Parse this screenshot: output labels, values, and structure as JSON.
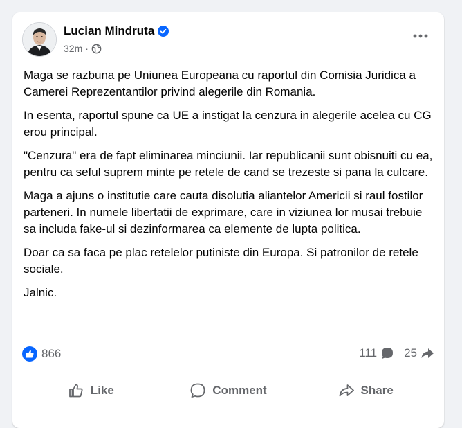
{
  "post": {
    "author": "Lucian Mindruta",
    "time": "32m",
    "separator": "·",
    "paragraphs": [
      "Maga se razbuna pe Uniunea Europeana cu raportul din Comisia Juridica a Camerei Reprezentantilor privind alegerile din Romania.",
      "In esenta, raportul spune ca UE a instigat la cenzura in alegerile acelea cu CG erou principal.",
      "\"Cenzura\" era de fapt eliminarea minciunii. Iar republicanii sunt obisnuiti cu ea, pentru ca seful suprem minte pe retele de cand se trezeste si pana la culcare.",
      "Maga a ajuns o institutie care cauta disolutia aliantelor Americii si raul fostilor parteneri. In numele libertatii de exprimare, care in viziunea lor musai trebuie sa includa fake-ul si dezinformarea ca elemente de lupta politica.",
      "Doar ca sa faca pe plac retelelor putiniste din Europa. Si patronilor de retele sociale.",
      "Jalnic."
    ]
  },
  "stats": {
    "likes": "866",
    "comments": "111",
    "shares": "25"
  },
  "actions": {
    "like": "Like",
    "comment": "Comment",
    "share": "Share"
  },
  "icons": {
    "verified": "verified-badge-icon",
    "privacy": "globe-icon",
    "more": "more-options-icon",
    "like_reaction": "like-reaction-icon",
    "comment_count": "comment-bubble-icon",
    "share_count": "share-arrow-icon",
    "like_action": "thumbs-up-icon",
    "comment_action": "comment-icon",
    "share_action": "share-icon"
  },
  "colors": {
    "accent": "#0866ff",
    "secondary_text": "#65676b",
    "background": "#f0f2f5",
    "card": "#ffffff"
  }
}
